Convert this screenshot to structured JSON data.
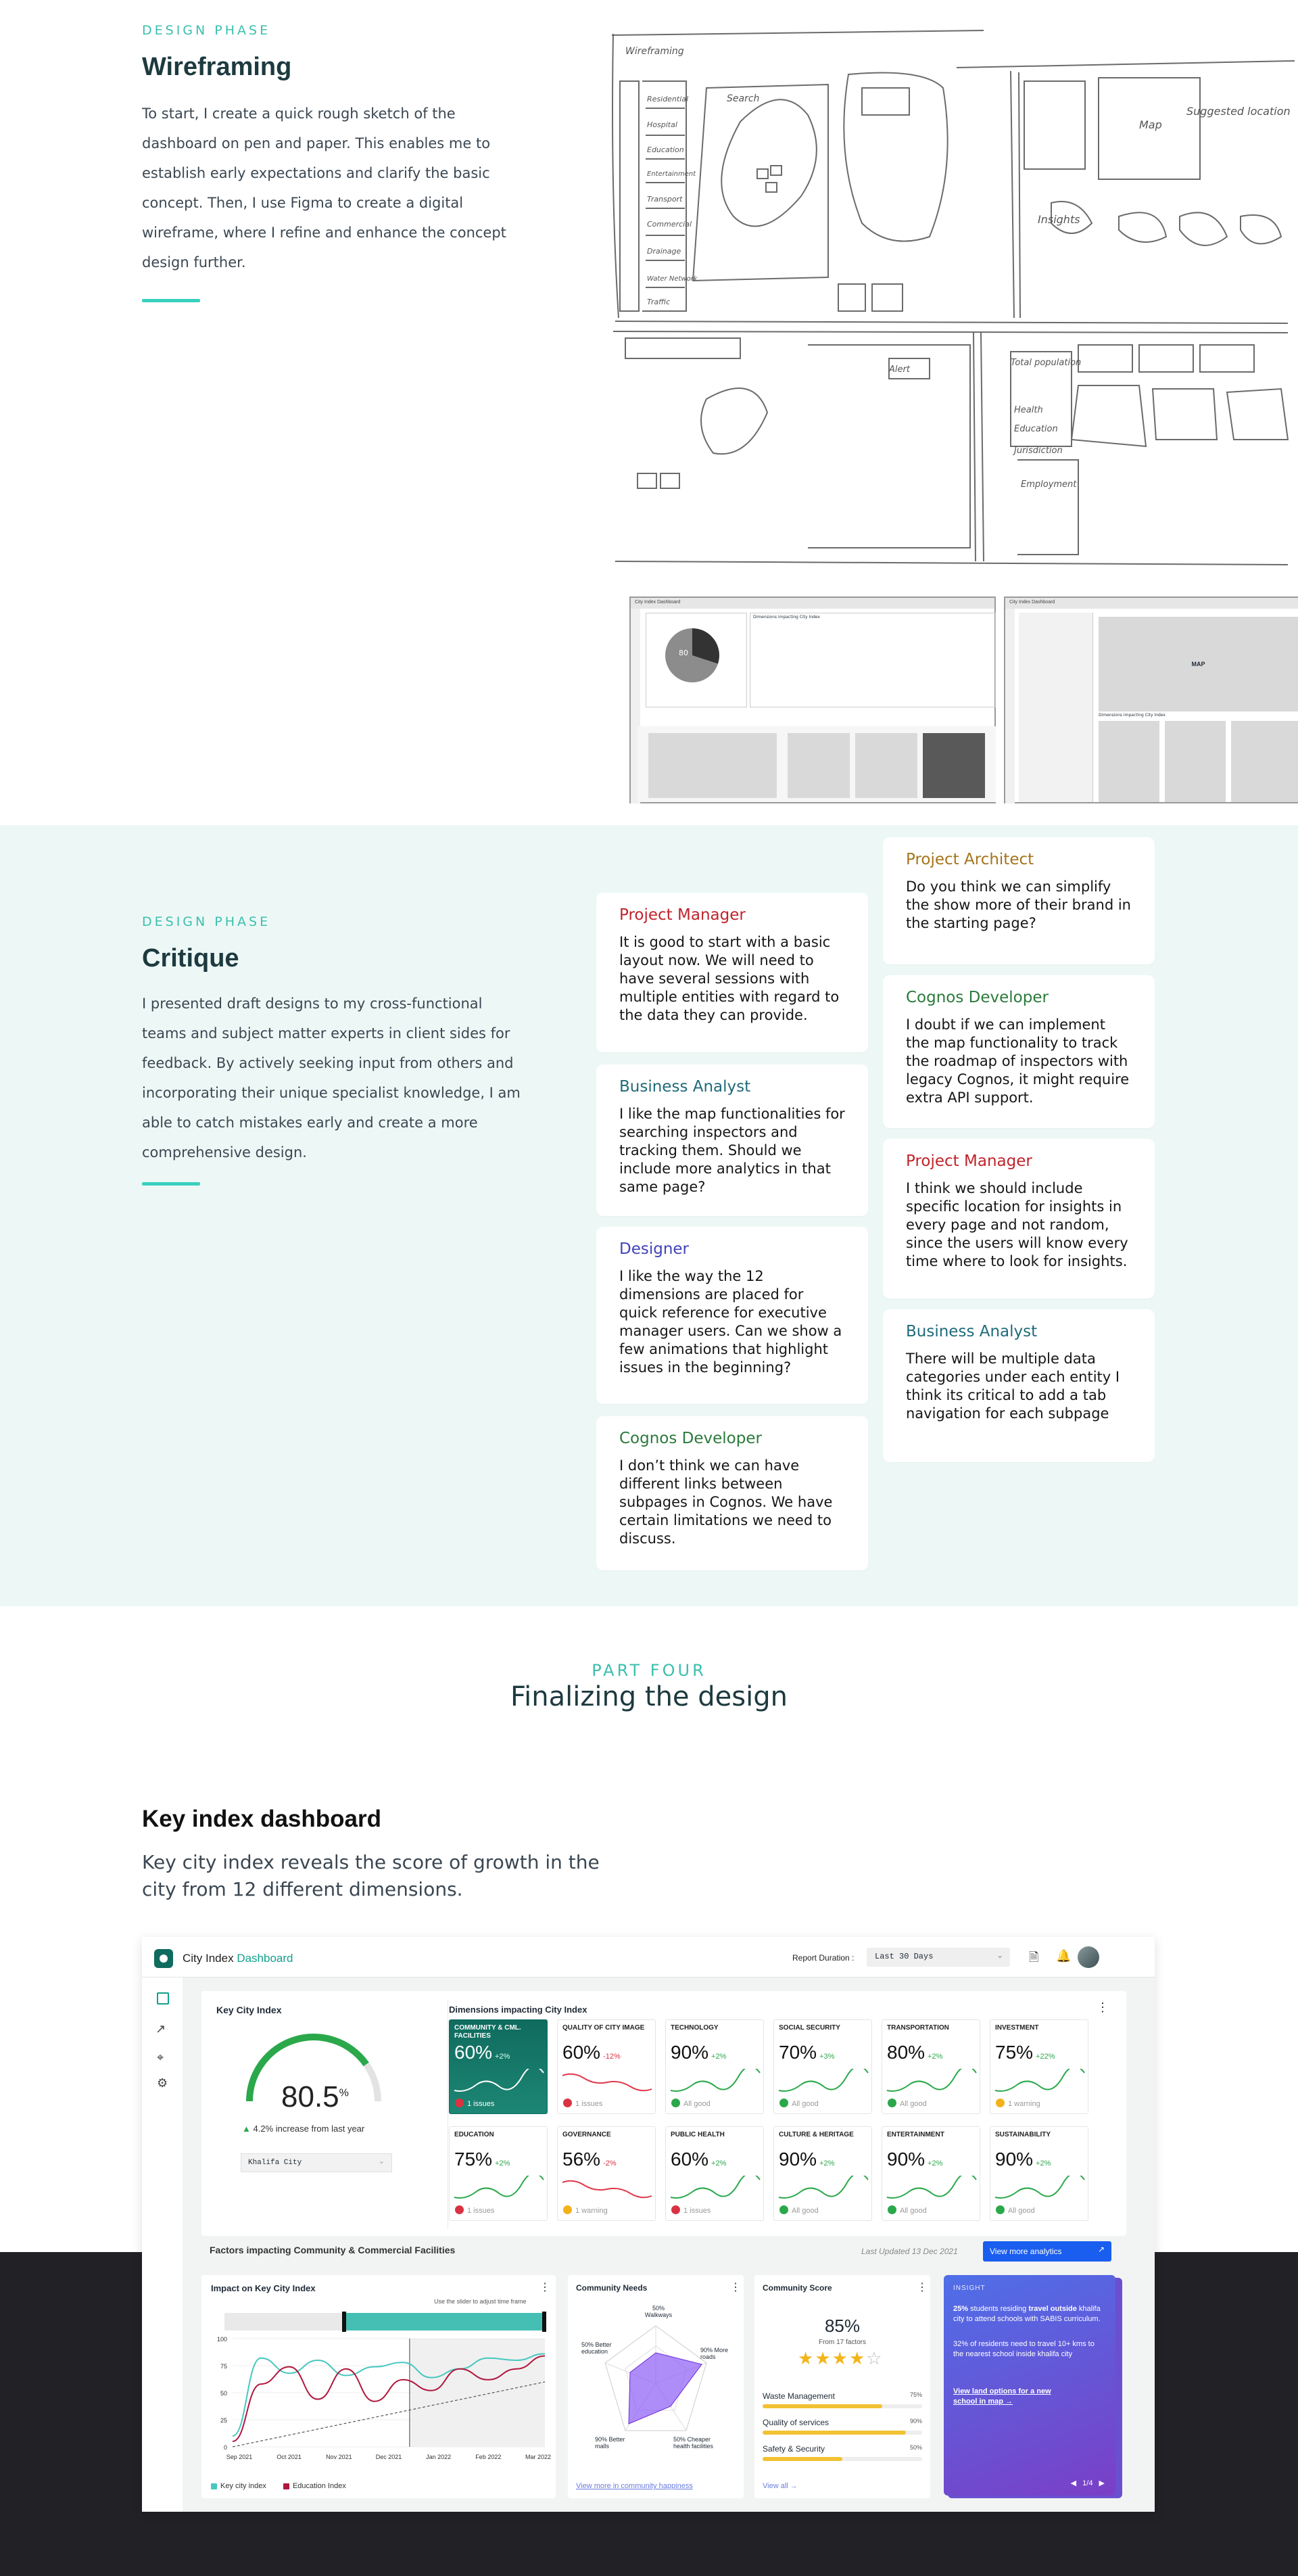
{
  "wireframing": {
    "eyebrow": "DESIGN PHASE",
    "title": "Wireframing",
    "body": "To start, I create a quick rough sketch of the dashboard on pen and paper. This enables me to establish early expectations and clarify the basic concept. Then, I use Figma to create a digital wireframe, where I refine and enhance the concept design further.",
    "sketch_notes": [
      "Wireframing",
      "Search",
      "Residential",
      "Hospital",
      "Education",
      "Entertainment",
      "Transport",
      "Commercial",
      "Drainage",
      "Water Network",
      "Traffic",
      "Suggested location",
      "Total population",
      "Health",
      "Education",
      "Jurisdiction",
      "Employment",
      "Insights",
      "Map",
      "Alert"
    ],
    "digital": {
      "left_header": "City Index Dashboard",
      "left_pie_label": "80",
      "left_section": "Dimensions impacting City Index",
      "right_header": "City Index Dashboard",
      "right_map_label": "MAP",
      "right_section": "Dimensions impacting City Index"
    }
  },
  "critique": {
    "eyebrow": "DESIGN PHASE",
    "title": "Critique",
    "body": "I presented draft designs to my cross-functional teams and subject matter experts in client sides for feedback. By actively seeking input from others and incorporating their unique specialist knowledge, I am able to catch mistakes early and create a more comprehensive design.",
    "cards": [
      {
        "role": "Project Manager",
        "color": "#c0232a",
        "quote": "It is good to start with a basic layout now. We will need to have several sessions with multiple entities with regard to the data they can provide."
      },
      {
        "role": "Business Analyst",
        "color": "#1f6a7a",
        "quote": "I like the map functionalities for searching inspectors and tracking them. Should we include more analytics in that same page?"
      },
      {
        "role": "Designer",
        "color": "#4043b8",
        "quote": "I like the way the 12 dimensions are placed for quick reference for executive manager users. Can we show a few  animations that highlight issues in the beginning?"
      },
      {
        "role": "Cognos Developer",
        "color": "#2b7a3b",
        "quote": "I don’t think we can have different links between subpages in Cognos. We have certain limitations we need to discuss."
      },
      {
        "role": "Project Architect",
        "color": "#a5741a",
        "quote": "Do you think we can simplify the show more of their brand in the starting page?"
      },
      {
        "role": "Cognos Developer",
        "color": "#2b7a3b",
        "quote": "I doubt if we can implement the map functionality to track the roadmap of inspectors with legacy Cognos, it might require extra API support."
      },
      {
        "role": "Project Manager",
        "color": "#c0232a",
        "quote": "I think we should include specific location for insights in every page and not random, since the users will know every time where to look for insights."
      },
      {
        "role": "Business Analyst",
        "color": "#1f6a7a",
        "quote": "There will be multiple data categories under each entity I think its critical to add a tab navigation for each subpage"
      }
    ]
  },
  "part_four": {
    "eyebrow": "PART FOUR",
    "title": "Finalizing the design"
  },
  "key_index": {
    "title": "Key index dashboard",
    "subtitle": "Key city index reveals the score of growth in the city from 12 different dimensions."
  },
  "dashboard": {
    "app_title": "City Index",
    "app_title_accent": "Dashboard",
    "report_label": "Report Duration :",
    "report_value": "Last 30 Days",
    "key_city_index": {
      "title": "Key City Index",
      "value": "80.5",
      "unit": "%",
      "gauge_fraction": 0.805,
      "change": "4.2% increase from last year",
      "select": "Khalifa City"
    },
    "dimensions_title": "Dimensions impacting  City Index",
    "tiles": [
      {
        "name": "COMMUNITY & CML. FACILITIES",
        "value": "60%",
        "delta": "+2%",
        "status": "1 issues",
        "kind": "active"
      },
      {
        "name": "QUALITY OF CITY IMAGE",
        "value": "60%",
        "delta": "-12%",
        "status": "1 issues",
        "kind": "issue"
      },
      {
        "name": "TECHNOLOGY",
        "value": "90%",
        "delta": "+2%",
        "status": "All good",
        "kind": "good"
      },
      {
        "name": "SOCIAL SECURITY",
        "value": "70%",
        "delta": "+3%",
        "status": "All good",
        "kind": "good"
      },
      {
        "name": "TRANSPORTATION",
        "value": "80%",
        "delta": "+2%",
        "status": "All good",
        "kind": "good"
      },
      {
        "name": "INVESTMENT",
        "value": "75%",
        "delta": "+22%",
        "status": "1 warning",
        "kind": "warning"
      },
      {
        "name": "EDUCATION",
        "value": "75%",
        "delta": "+2%",
        "status": "1 issues",
        "kind": "issue-good"
      },
      {
        "name": "GOVERNANCE",
        "value": "56%",
        "delta": "-2%",
        "status": "1 warning",
        "kind": "warning-bad"
      },
      {
        "name": "PUBLIC HEALTH",
        "value": "60%",
        "delta": "+2%",
        "status": "1 issues",
        "kind": "issue-good"
      },
      {
        "name": "CULTURE & HERITAGE",
        "value": "90%",
        "delta": "+2%",
        "status": "All good",
        "kind": "good"
      },
      {
        "name": "ENTERTAINMENT",
        "value": "90%",
        "delta": "+2%",
        "status": "All good",
        "kind": "good"
      },
      {
        "name": "SUSTAINABILITY",
        "value": "90%",
        "delta": "+2%",
        "status": "All good",
        "kind": "good"
      }
    ],
    "factors_title": "Factors impacting Community & Commercial Facilities",
    "last_updated": "Last Updated 13 Dec 2021",
    "analytics_button": "View more analytics",
    "impact": {
      "title": "Impact on Key City Index",
      "slider_hint": "Use the slider to adjust time frame",
      "legend": [
        "Key city index",
        "Education Index"
      ]
    },
    "community_needs": {
      "title": "Community Needs",
      "labels": [
        "50% Walkways",
        "90% More roads",
        "50% Cheaper health facilities",
        "90% Better malls",
        "50% Better education"
      ],
      "link": "View more in community happiness"
    },
    "community_score": {
      "title": "Community Score",
      "value": "85%",
      "sub": "From 17 factors",
      "stars": 3.5,
      "bars": [
        {
          "label": "Waste Management",
          "value": "75%",
          "fraction": 0.75
        },
        {
          "label": "Quality of services",
          "value": "90%",
          "fraction": 0.9
        },
        {
          "label": "Safety & Security",
          "value": "50%",
          "fraction": 0.5
        }
      ],
      "link": "View all"
    },
    "insight": {
      "title": "INSIGHT",
      "p1_strong": "25%",
      "p1_a": " students residing ",
      "p1_bold2": "travel outside",
      "p1_b": " khalifa city to attend schools with SABIS curriculum.",
      "p2": "32% of residents need to travel 10+ kms to the nearest school inside khalifa city",
      "link": "View land options for a new school in map →",
      "pager": "1/4"
    }
  },
  "chart_data": {
    "type": "line",
    "title": "Impact on Key City Index",
    "x": [
      "Sep 2021",
      "Oct 2021",
      "Nov 2021",
      "Dec 2021",
      "Jan 2022",
      "Feb 2022",
      "Mar 2022"
    ],
    "ylim": [
      0,
      100
    ],
    "yticks": [
      0,
      25,
      50,
      75,
      100
    ],
    "series": [
      {
        "name": "Key city index",
        "color": "#46c7c0",
        "values": [
          10,
          82,
          68,
          80,
          66,
          74,
          78,
          64,
          72,
          82,
          80,
          86
        ]
      },
      {
        "name": "Education Index",
        "color": "#b0183e",
        "values": [
          5,
          58,
          74,
          44,
          72,
          42,
          62,
          52,
          72,
          62,
          72,
          84
        ]
      }
    ],
    "trend": {
      "values": [
        0,
        60
      ]
    },
    "grid": true,
    "legend": "bottom-left"
  }
}
